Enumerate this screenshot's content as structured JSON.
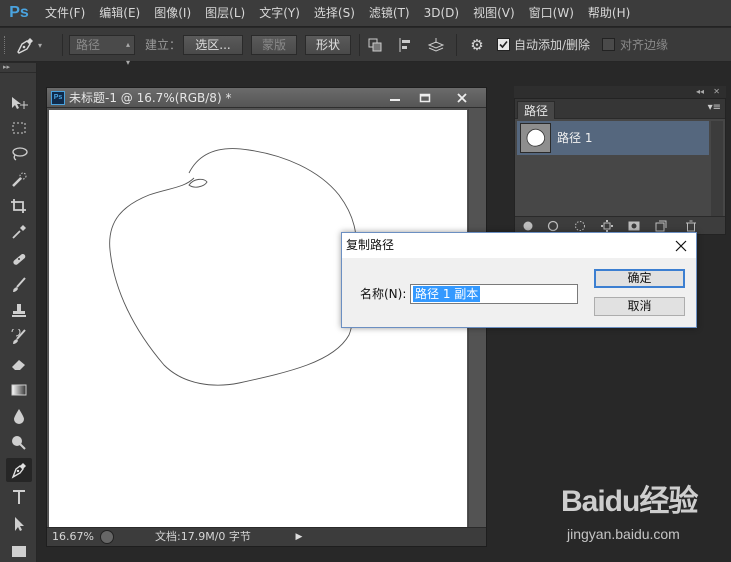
{
  "app": {
    "logo": "Ps",
    "accent": "#4aa3df"
  },
  "menu": [
    "文件(F)",
    "编辑(E)",
    "图像(I)",
    "图层(L)",
    "文字(Y)",
    "选择(S)",
    "滤镜(T)",
    "3D(D)",
    "视图(V)",
    "窗口(W)",
    "帮助(H)"
  ],
  "options_bar": {
    "tool_icon": "pen-icon",
    "mode_select": "路径",
    "make_label": "建立：",
    "selection_button": "选区...",
    "mask_button": "蒙版",
    "shape_button": "形状",
    "auto_add_delete": {
      "label": "自动添加/删除",
      "checked": true
    },
    "align_edges": {
      "label": "对齐边缘",
      "checked": false
    }
  },
  "toolbox": {
    "tools": [
      "move-icon",
      "marquee-icon",
      "lasso-icon",
      "quick-select-icon",
      "crop-icon",
      "eyedropper-icon",
      "healing-icon",
      "brush-icon",
      "stamp-icon",
      "history-brush-icon",
      "eraser-icon",
      "gradient-icon",
      "blur-icon",
      "dodge-icon",
      "pen-icon",
      "type-icon",
      "path-select-icon",
      "rectangle-icon"
    ],
    "active": "pen-icon"
  },
  "document": {
    "title": "未标题-1 @ 16.7%(RGB/8) *",
    "zoom": "16.67%",
    "status": "文档:17.9M/0 字节",
    "canvas_color": "#ffffff"
  },
  "paths_panel": {
    "tab": "路径",
    "items": [
      {
        "name": "路径 1",
        "selected": true
      }
    ],
    "selected_color": "#55677e"
  },
  "dialog": {
    "title": "复制路径",
    "name_label": "名称(N):",
    "name_value": "路径 1 副本",
    "ok_button": "确定",
    "cancel_button": "取消"
  },
  "watermark": {
    "logo_text": "Baidu经验",
    "url": "jingyan.baidu.com"
  }
}
